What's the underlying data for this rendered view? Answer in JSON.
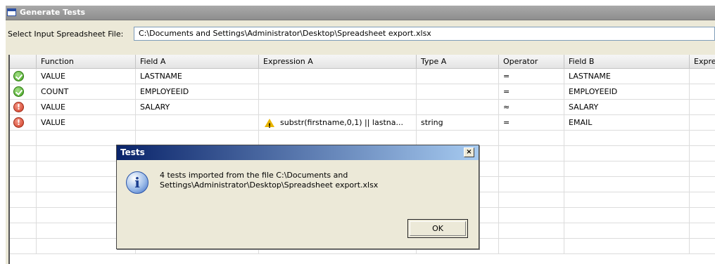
{
  "window": {
    "title": "Generate Tests"
  },
  "file_select": {
    "label": "Select Input Spreadsheet File:",
    "value": "C:\\Documents and Settings\\Administrator\\Desktop\\Spreadsheet export.xlsx"
  },
  "table": {
    "columns": [
      "Function",
      "Field A",
      "Expression A",
      "Type A",
      "Operator",
      "Field B",
      "Expre"
    ],
    "rows": [
      {
        "status": "ok",
        "function": "VALUE",
        "field_a": "LASTNAME",
        "expression_a": "",
        "type_a": "",
        "operator": "=",
        "field_b": "LASTNAME"
      },
      {
        "status": "ok",
        "function": "COUNT",
        "field_a": "EMPLOYEEID",
        "expression_a": "",
        "type_a": "",
        "operator": "=",
        "field_b": "EMPLOYEEID"
      },
      {
        "status": "error",
        "function": "VALUE",
        "field_a": "SALARY",
        "expression_a": "",
        "type_a": "",
        "operator": "≈",
        "field_b": "SALARY"
      },
      {
        "status": "error",
        "function": "VALUE",
        "field_a": "",
        "expression_a": "substr(firstname,0,1) || lastna...",
        "type_a": "string",
        "operator": "=",
        "field_b": "EMAIL"
      }
    ]
  },
  "dialog": {
    "title": "Tests",
    "message_line1": "4 tests imported from the file C:\\Documents and",
    "message_line2": "Settings\\Administrator\\Desktop\\Spreadsheet export.xlsx",
    "ok_label": "OK",
    "close_glyph": "×"
  }
}
